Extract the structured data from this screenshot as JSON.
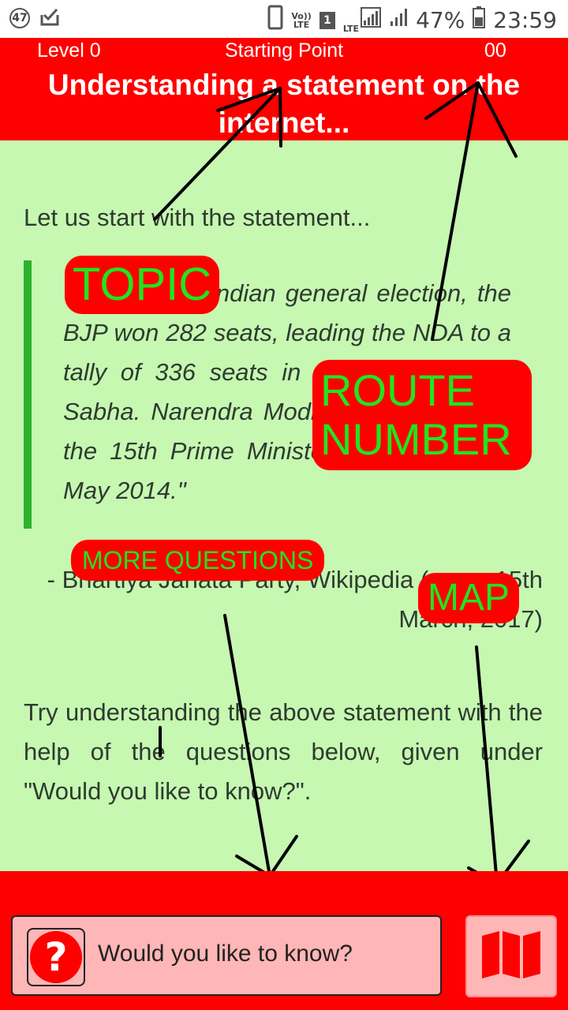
{
  "status_bar": {
    "notification_count": "47",
    "volte_top": "Vo))",
    "volte_bottom": "LTE",
    "sim_number": "1",
    "lte_label": "LTE",
    "battery": "47%",
    "time": "23:59"
  },
  "header": {
    "level": "Level 0",
    "route_name": "Starting Point",
    "route_number": "00",
    "title": "Understanding a statement on the internet..."
  },
  "main": {
    "intro": "Let us start with the statement...",
    "quote": "\"In the 2014 Indian general election, the BJP won 282 seats, leading the NDA to a tally of 336 seats in the 543-seat Lok Sabha. Narendra Modi was sworn in as the 15th Prime Minister of India on 26 May 2014.\"",
    "attribution": "- Bhartiya Janata Party, Wikipedia (as on 15th March, 2017)",
    "instruction": "Try understanding the above statement with the help of the questions below, given under \"Would you like to know?\"."
  },
  "annotations": {
    "topic": "TOPIC",
    "route_number": "ROUTE NUMBER",
    "more_questions": "MORE QUESTIONS",
    "map": "MAP"
  },
  "bottom": {
    "know_button_label": "Would you like to know?",
    "know_icon": "question-icon",
    "map_icon": "map-icon"
  },
  "colors": {
    "header_red": "#ff0000",
    "background_green": "#c6f8b2",
    "quote_bar_green": "#2db22d",
    "button_pink": "#ffb6b6",
    "annotation_green": "#1fe51f"
  }
}
